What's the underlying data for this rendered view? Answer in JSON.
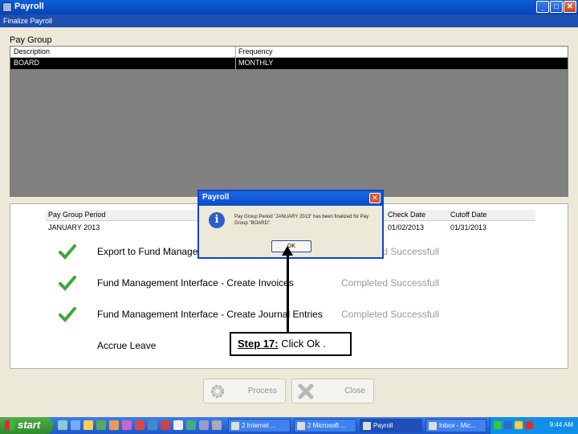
{
  "window": {
    "title": "Payroll",
    "subtitle": "Finalize Payroll",
    "min": "_",
    "max": "□",
    "close": "✕"
  },
  "pay_group": {
    "section_title": "Pay Group",
    "columns": [
      "Description",
      "Frequency"
    ],
    "row": [
      "BOARD",
      "MONTHLY"
    ]
  },
  "period_table": {
    "columns": [
      "Pay Group Period",
      "Check Date",
      "Cutoff Date"
    ],
    "row": [
      "JANUARY 2013",
      "01/02/2013",
      "01/31/2013"
    ]
  },
  "steps": [
    {
      "label": "Export to Fund Management",
      "status": "Completed Successfull",
      "done": true
    },
    {
      "label": "Fund Management Interface - Create Invoices",
      "status": "Completed Successfull",
      "done": true
    },
    {
      "label": "Fund Management Interface - Create Journal Entries",
      "status": "Completed Successfull",
      "done": true
    },
    {
      "label": "Accrue Leave",
      "status": "",
      "done": false
    }
  ],
  "buttons": {
    "process": "Process",
    "close": "Close"
  },
  "dialog": {
    "title": "Payroll",
    "message": "Pay Group Period \"JANUARY 2013\" has been finalized for Pay Group \"BOARD\".",
    "ok": "OK",
    "icon": "info-icon",
    "close": "✕"
  },
  "callout": {
    "step_label": "Step 17:",
    "text": " Click Ok ."
  },
  "taskbar": {
    "start": "start",
    "tasks": [
      {
        "label": "2 Internet ...",
        "active": false
      },
      {
        "label": "2 Microsoft ...",
        "active": false
      },
      {
        "label": "Payroll",
        "active": true
      },
      {
        "label": "Inbox - Mic...",
        "active": false
      }
    ],
    "clock": "9:44 AM"
  },
  "colors": {
    "titlebar": "#0A5FD8",
    "selected_row": "#000000",
    "grid_bg": "#808080",
    "check_green": "#3fa63a"
  }
}
